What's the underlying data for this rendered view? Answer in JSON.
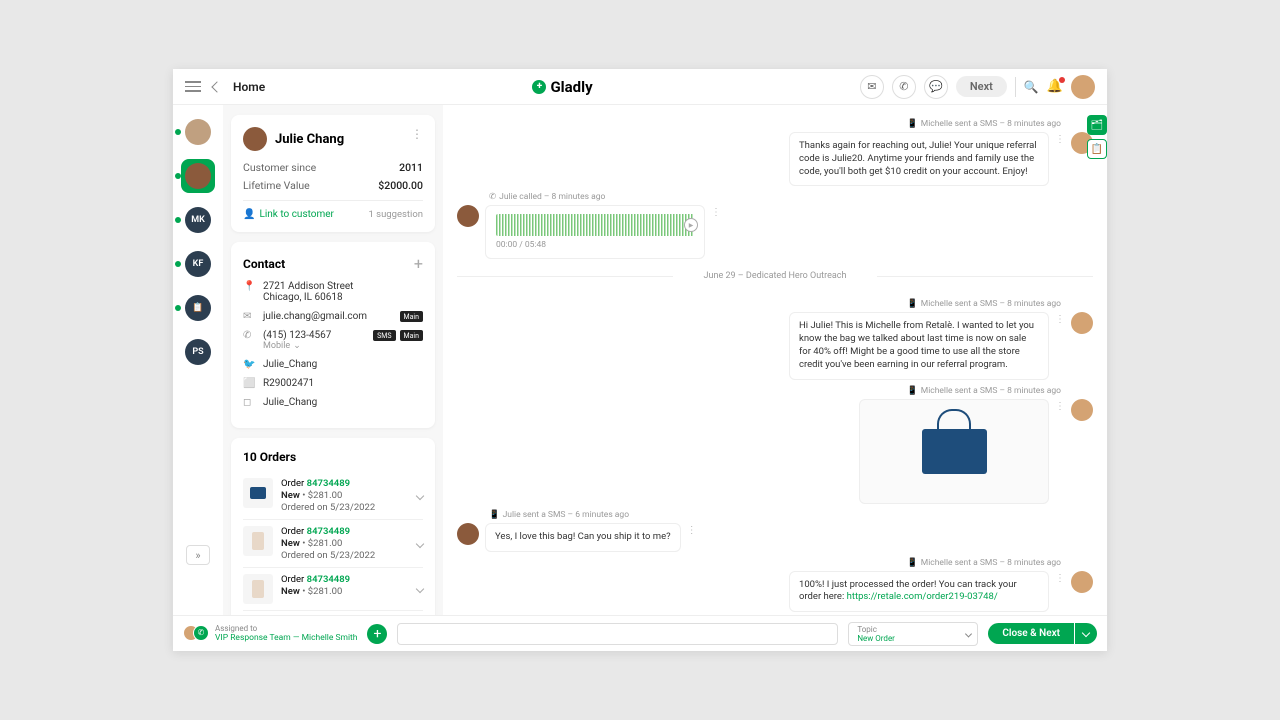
{
  "header": {
    "home": "Home",
    "brand": "Gladly",
    "next": "Next"
  },
  "nav_strip": [
    {
      "type": "avatar",
      "label": "",
      "cls": "img1",
      "online": true
    },
    {
      "type": "avatar",
      "label": "",
      "cls": "img2",
      "online": true,
      "active": true
    },
    {
      "type": "initials",
      "label": "MK",
      "online": true
    },
    {
      "type": "initials",
      "label": "KF",
      "online": true
    },
    {
      "type": "icon",
      "label": "📋",
      "online": true
    },
    {
      "type": "initials",
      "label": "PS",
      "online": false
    }
  ],
  "customer": {
    "name": "Julie Chang",
    "since_label": "Customer since",
    "since_value": "2011",
    "ltv_label": "Lifetime Value",
    "ltv_value": "$2000.00",
    "link": "Link to customer",
    "suggestion": "1 suggestion"
  },
  "contact": {
    "title": "Contact",
    "address_line1": "2721 Addison Street",
    "address_line2": "Chicago, IL 60618",
    "email": "julie.chang@gmail.com",
    "email_badge": "Main",
    "phone": "(415) 123-4567",
    "phone_type": "Mobile",
    "phone_badge1": "SMS",
    "phone_badge2": "Main",
    "twitter": "Julie_Chang",
    "facebook": "R29002471",
    "instagram": "Julie_Chang"
  },
  "orders": {
    "title": "10 Orders",
    "items": [
      {
        "label": "Order",
        "num": "84734489",
        "status": "New",
        "price": "$281.00",
        "date": "Ordered on 5/23/2022",
        "thumb": "bag"
      },
      {
        "label": "Order",
        "num": "84734489",
        "status": "New",
        "price": "$281.00",
        "date": "Ordered on 5/23/2022",
        "thumb": "dress"
      },
      {
        "label": "Order",
        "num": "84734489",
        "status": "New",
        "price": "$281.00",
        "date": "",
        "thumb": "dress"
      }
    ]
  },
  "timeline": {
    "m1_meta": "Michelle sent a SMS – 8 minutes ago",
    "m1_body": "Thanks again for reaching out, Julie! Your unique referral code is Julie20. Anytime your friends and family use the code, you'll both get $10 credit on your account. Enjoy!",
    "call_meta": "Julie called – 8 minutes ago",
    "call_time": "00:00 / 05:48",
    "divider": "June 29 – Dedicated Hero Outreach",
    "m2_meta": "Michelle sent a SMS – 8 minutes ago",
    "m2_body": "Hi Julie! This is Michelle from Retalè. I wanted to let you know the bag we talked about last time is now on sale for 40% off! Might be a good time to use all the store credit you've been earning in our referral program.",
    "m3_meta": "Michelle sent a SMS – 8 minutes ago",
    "m4_meta": "Julie sent a SMS – 6 minutes ago",
    "m4_body": "Yes, I love this bag! Can you ship it to me?",
    "m5_meta": "Michelle sent a SMS – 8 minutes ago",
    "m5_body_a": "100%! I just processed the order! You can track your order here: ",
    "m5_link": "https://retale.com/order219-03748/"
  },
  "footer": {
    "assigned_label": "Assigned to",
    "assigned_value": "VIP Response Team  —  Michelle Smith",
    "topic_label": "Topic",
    "topic_value": "New Order",
    "close_next": "Close & Next"
  }
}
